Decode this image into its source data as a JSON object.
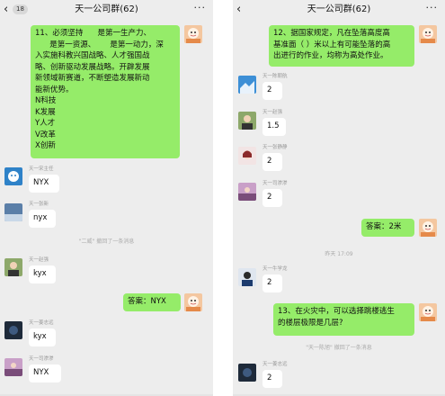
{
  "left": {
    "header": {
      "back_glyph": "‹",
      "unread_count": "18",
      "title": "天一公司群(62)",
      "more_glyph": "···"
    },
    "messages": [
      {
        "sender": "",
        "side": "right",
        "text": "11、必须坚持      是第一生产力、\n      是第一资源、      是第一动力，深\n入实施科教兴国战略、人才强国战\n略、创新驱动发展战略。开辟发展\n新领域新赛道，不断塑造发展新动\n能新优势。\nN科技\nK发展\nY人才\nV改革\nX创新"
      },
      {
        "sender": "天一宋主任",
        "side": "left",
        "text": "NYX"
      },
      {
        "sender": "天一张新",
        "side": "left",
        "text": "nyx"
      },
      {
        "system": "\"二威\" 撤回了一条消息"
      },
      {
        "sender": "天一赵强",
        "side": "left",
        "text": "kyx"
      },
      {
        "sender": "",
        "side": "right",
        "text": "答案：NYX"
      },
      {
        "sender": "天一姜志远",
        "side": "left",
        "text": "kyx"
      },
      {
        "sender": "天一司渗渗",
        "side": "left",
        "text": "NYX"
      }
    ]
  },
  "right": {
    "header": {
      "back_glyph": "‹",
      "title": "天一公司群(62)",
      "more_glyph": "···"
    },
    "messages": [
      {
        "sender": "",
        "side": "right",
        "text": "12、据国家规定，凡在坠落高度高\n基准面（ ）米以上有可能坠落的高\n出进行的作业，均称为高处作业。"
      },
      {
        "sender": "天一陈朝航",
        "side": "left",
        "text": "2"
      },
      {
        "sender": "天一赵强",
        "side": "left",
        "text": "1.5"
      },
      {
        "sender": "天一张静静",
        "side": "left",
        "text": "2"
      },
      {
        "sender": "天一司渗渗",
        "side": "left",
        "text": "2"
      },
      {
        "sender": "",
        "side": "right",
        "text": "答案：2米"
      },
      {
        "system": "昨天 17:09"
      },
      {
        "sender": "天一牛学龙",
        "side": "left",
        "text": "2"
      },
      {
        "sender": "",
        "side": "right",
        "text": "13、在火灾中，可以选择跳楼逃生\n的楼层极限是几层?"
      },
      {
        "system": "\"天一陈旭\" 撤回了一条消息"
      },
      {
        "sender": "天一姜志远",
        "side": "left",
        "text": "2"
      }
    ]
  },
  "colors": {
    "chat_bg": "#ededed",
    "my_bubble": "#95ec69",
    "their_bubble": "#ffffff",
    "system_text": "#aaaaaa"
  },
  "icons": [
    "back-chevron-icon",
    "more-dots-icon"
  ]
}
